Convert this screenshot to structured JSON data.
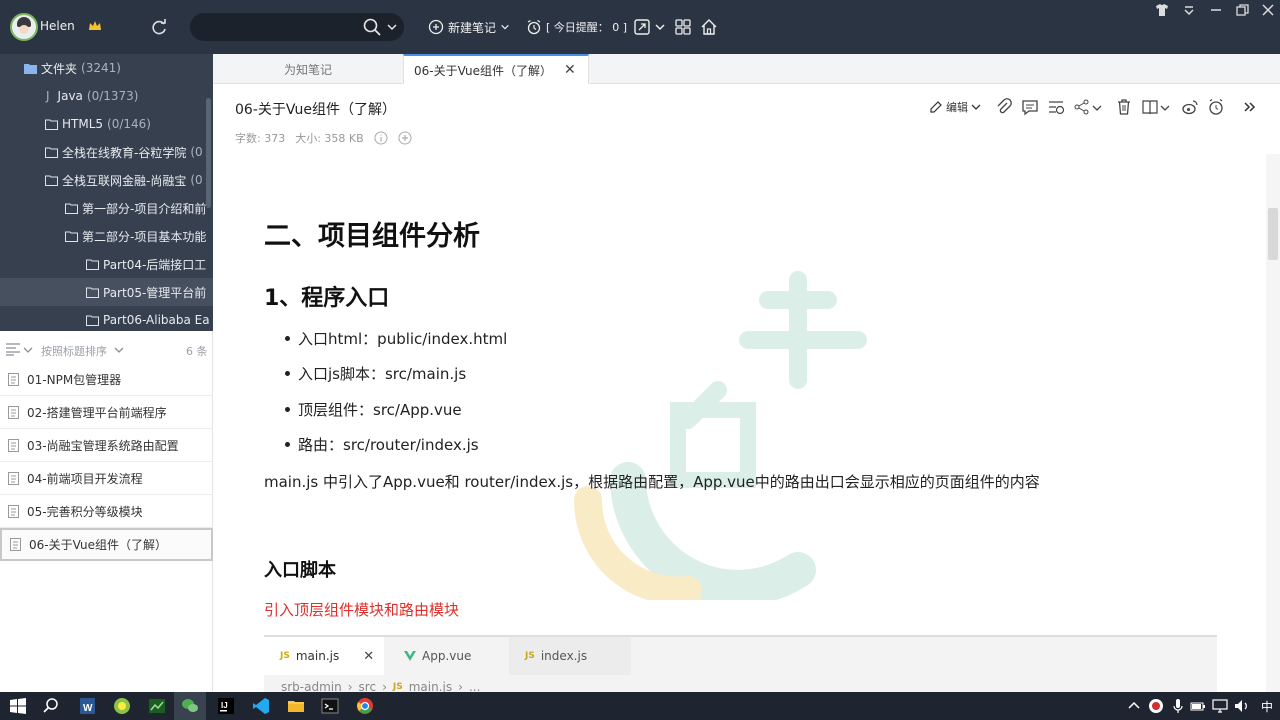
{
  "user": {
    "name": "Helen"
  },
  "search": {
    "value": "",
    "placeholder": ""
  },
  "toolbar": {
    "new_note_label": "新建笔记",
    "reminder_label": "[ 今日提醒： 0 ]"
  },
  "sidebar": {
    "tree": [
      {
        "label": "文件夹",
        "count": "(3241)"
      },
      {
        "label": "Java",
        "count": "(0/1373)"
      },
      {
        "label": "HTML5",
        "count": "(0/146)"
      },
      {
        "label": "全栈在线教育-谷粒学院",
        "count": "(0"
      },
      {
        "label": "全栈互联网金融-尚融宝",
        "count": "(0"
      },
      {
        "label": "第一部分-项目介绍和前",
        "count": ""
      },
      {
        "label": "第二部分-项目基本功能",
        "count": ""
      },
      {
        "label": "Part04-后端接口工",
        "count": ""
      },
      {
        "label": "Part05-管理平台前",
        "count": ""
      },
      {
        "label": "Part06-Alibaba Ea",
        "count": ""
      }
    ],
    "sort_label": "按照标题排序",
    "sort_count": "6 条",
    "notes": [
      "01-NPM包管理器",
      "02-搭建管理平台前端程序",
      "03-尚融宝管理系统路由配置",
      "04-前端项目开发流程",
      "05-完善积分等级模块",
      "06-关于Vue组件（了解）"
    ]
  },
  "tabs": [
    {
      "label": "为知笔记"
    },
    {
      "label": "06-关于Vue组件（了解）"
    }
  ],
  "doc": {
    "title": "06-关于Vue组件（了解）",
    "word_count": "字数: 373",
    "size": "大小: 358 KB",
    "edit_label": "编辑"
  },
  "content": {
    "h2": "二、项目组件分析",
    "h3": "1、程序入口",
    "bullets": [
      "入口html：public/index.html",
      "入口js脚本：src/main.js",
      "顶层组件：src/App.vue",
      "路由：src/router/index.js"
    ],
    "para": "main.js 中引入了App.vue和 router/index.js，根据路由配置，App.vue中的路由出口会显示相应的页面组件的内容",
    "h4": "入口脚本",
    "red_text": "引入顶层组件模块和路由模块",
    "code_tabs": [
      {
        "label": "main.js",
        "badge": "JS"
      },
      {
        "label": "App.vue",
        "badge": ""
      },
      {
        "label": "index.js",
        "badge": "JS"
      }
    ],
    "code_crumbs": [
      "srb-admin",
      "src",
      "main.js",
      "..."
    ]
  },
  "taskbar": {
    "ime_label": "中"
  },
  "colors": {
    "sidebar_bg": "#36404f",
    "topbar_bg": "#2b3442",
    "accent": "#4a8fe7",
    "red_text": "#e0302c",
    "taskbar_bg": "#1e2530"
  }
}
